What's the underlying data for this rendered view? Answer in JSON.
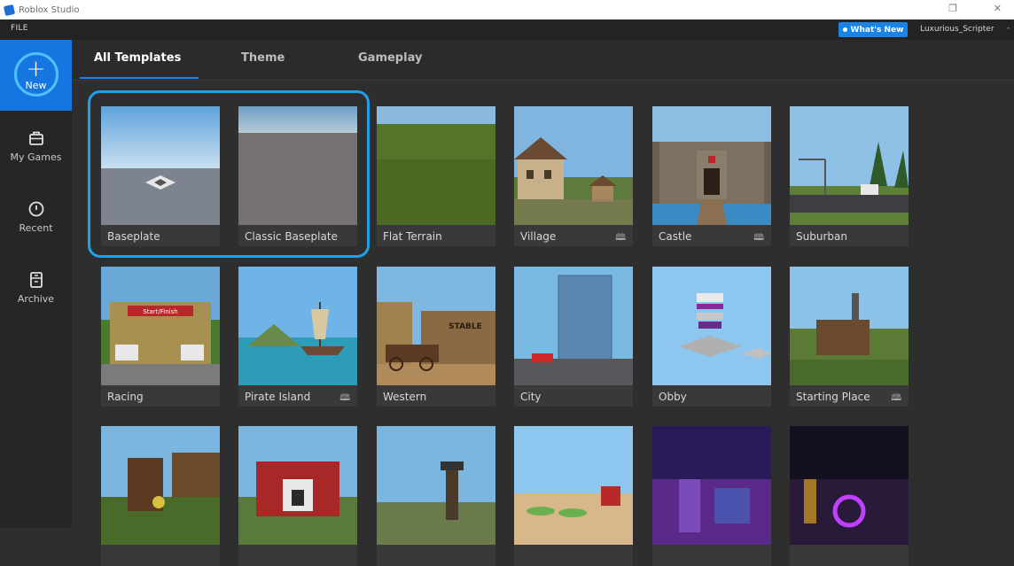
{
  "titlebar": {
    "title": "Roblox Studio",
    "restore_glyph": "❐",
    "close_glyph": "✕"
  },
  "menubar": {
    "file": "FILE",
    "whats_new": "What's New",
    "username": "Luxurious_Scripter",
    "caret": "-"
  },
  "sidebar": {
    "new": {
      "label": "New",
      "icon": "plus-icon",
      "glyph": "+"
    },
    "items": [
      {
        "label": "My Games",
        "icon": "briefcase-icon"
      },
      {
        "label": "Recent",
        "icon": "clock-icon"
      },
      {
        "label": "Archive",
        "icon": "archive-icon"
      }
    ]
  },
  "tabs": [
    {
      "label": "All Templates",
      "active": true
    },
    {
      "label": "Theme",
      "active": false
    },
    {
      "label": "Gameplay",
      "active": false
    }
  ],
  "book_glyph": "🕮",
  "templates": [
    {
      "label": "Baseplate",
      "book": false
    },
    {
      "label": "Classic Baseplate",
      "book": false
    },
    {
      "label": "Flat Terrain",
      "book": false
    },
    {
      "label": "Village",
      "book": true
    },
    {
      "label": "Castle",
      "book": true
    },
    {
      "label": "Suburban",
      "book": false
    },
    {
      "label": "Racing",
      "book": false
    },
    {
      "label": "Pirate Island",
      "book": true
    },
    {
      "label": "Western",
      "book": false
    },
    {
      "label": "City",
      "book": false
    },
    {
      "label": "Obby",
      "book": false
    },
    {
      "label": "Starting Place",
      "book": true
    },
    {
      "label": "",
      "book": false
    },
    {
      "label": "",
      "book": false
    },
    {
      "label": "",
      "book": false
    },
    {
      "label": "",
      "book": false
    },
    {
      "label": "",
      "book": false
    },
    {
      "label": "",
      "book": false
    }
  ],
  "colors": {
    "accent": "#1a83e6",
    "highlight": "#1ea0ea",
    "sidebar_active": "#1476de"
  },
  "scene_texts": {
    "racing_banner": "Start/Finish",
    "western_sign": "STABLE"
  }
}
